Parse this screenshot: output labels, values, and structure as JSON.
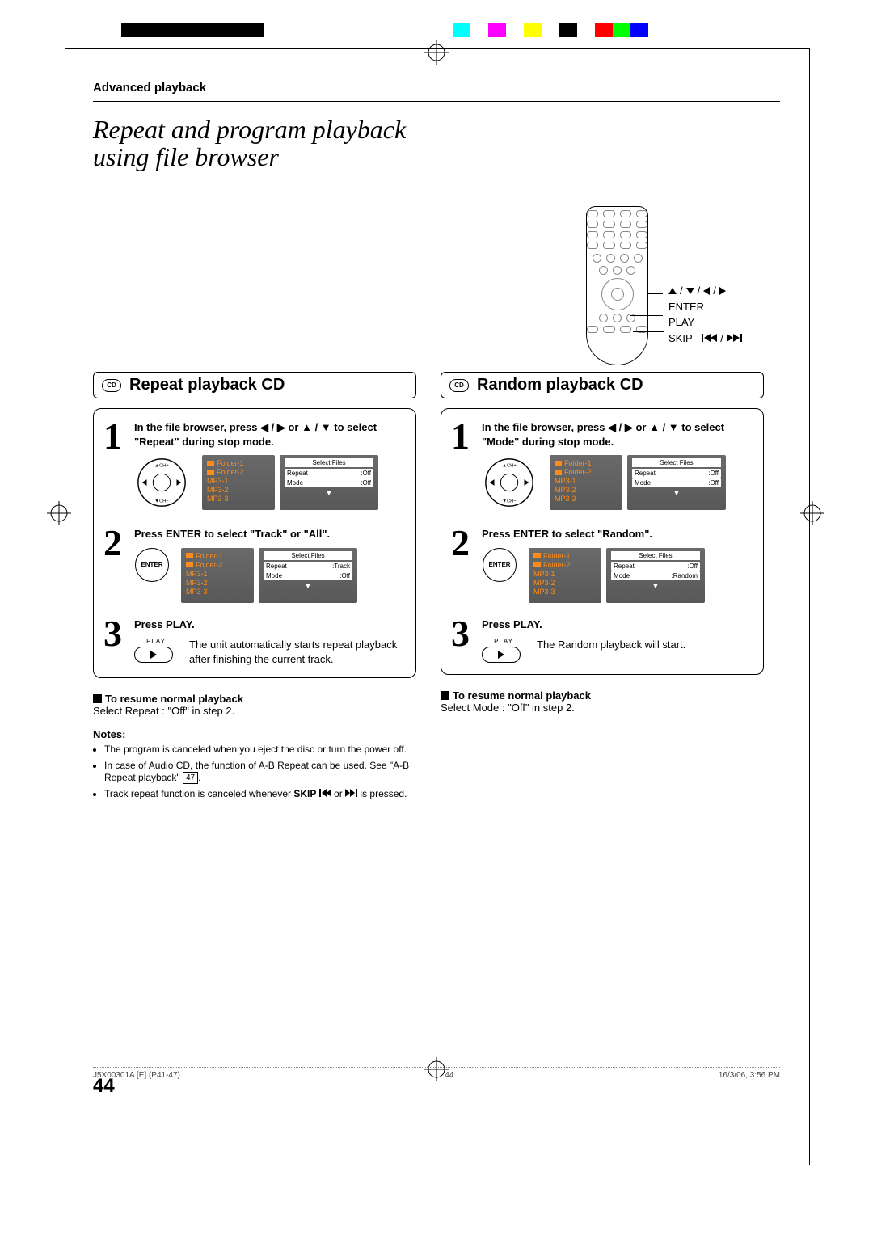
{
  "header": {
    "section": "Advanced playback"
  },
  "title": "Repeat and program playback using file browser",
  "remote_labels": {
    "dpad": "▲ / ▼ / ◀ / ▶",
    "enter": "ENTER",
    "play": "PLAY",
    "skip": "SKIP"
  },
  "left": {
    "heading": "Repeat playback CD",
    "cd_label": "CD",
    "step1": {
      "num": "1",
      "text": "In the file browser, press ◀ / ▶ or ▲ / ▼ to select \"Repeat\" during stop mode.",
      "fb": {
        "items": [
          "Folder-1",
          "Folder-2",
          "MP3-1",
          "MP3-2",
          "MP3-3"
        ],
        "select": "Select Files",
        "rows": [
          [
            "Repeat",
            ":Off"
          ],
          [
            "Mode",
            ":Off"
          ]
        ]
      }
    },
    "step2": {
      "num": "2",
      "text": "Press ENTER to select \"Track\" or \"All\".",
      "enter": "ENTER",
      "fb": {
        "items": [
          "Folder-1",
          "Folder-2",
          "MP3-1",
          "MP3-2",
          "MP3-3"
        ],
        "select": "Select Files",
        "rows": [
          [
            "Repeat",
            ":Track"
          ],
          [
            "Mode",
            ":Off"
          ]
        ]
      }
    },
    "step3": {
      "num": "3",
      "text": "Press PLAY.",
      "play_label": "PLAY",
      "desc": "The unit automatically starts repeat playback after finishing the current track."
    },
    "resume_title": "To resume normal playback",
    "resume_text": "Select Repeat : \"Off\" in step 2.",
    "notes_title": "Notes:",
    "notes": [
      "The program is canceled when you eject the disc or turn the power off.",
      "In case of Audio CD, the function of A-B Repeat can be used. See \"A-B Repeat playback\"",
      "Track repeat function is canceled whenever SKIP ⏮ or ⏭ is pressed."
    ],
    "page_ref": "47"
  },
  "right": {
    "heading": "Random playback CD",
    "cd_label": "CD",
    "step1": {
      "num": "1",
      "text": "In the file browser, press ◀ / ▶ or ▲ / ▼  to select \"Mode\" during stop mode.",
      "fb": {
        "items": [
          "Folder-1",
          "Folder-2",
          "MP3-1",
          "MP3-2",
          "MP3-3"
        ],
        "select": "Select Files",
        "rows": [
          [
            "Repeat",
            ":Off"
          ],
          [
            "Mode",
            ":Off"
          ]
        ]
      }
    },
    "step2": {
      "num": "2",
      "text": "Press ENTER to select \"Random\".",
      "enter": "ENTER",
      "fb": {
        "items": [
          "Folder-1",
          "Folder-2",
          "MP3-1",
          "MP3-2",
          "MP3-3"
        ],
        "select": "Select Files",
        "rows": [
          [
            "Repeat",
            ":Off"
          ],
          [
            "Mode",
            ":Random"
          ]
        ]
      }
    },
    "step3": {
      "num": "3",
      "text": "Press PLAY.",
      "play_label": "PLAY",
      "desc": "The Random playback will start."
    },
    "resume_title": "To resume normal playback",
    "resume_text": "Select Mode : \"Off\" in step 2."
  },
  "page_number": "44",
  "footer": {
    "left": "J5X00301A [E] (P41-47)",
    "center": "44",
    "right": "16/3/06, 3:56 PM"
  }
}
